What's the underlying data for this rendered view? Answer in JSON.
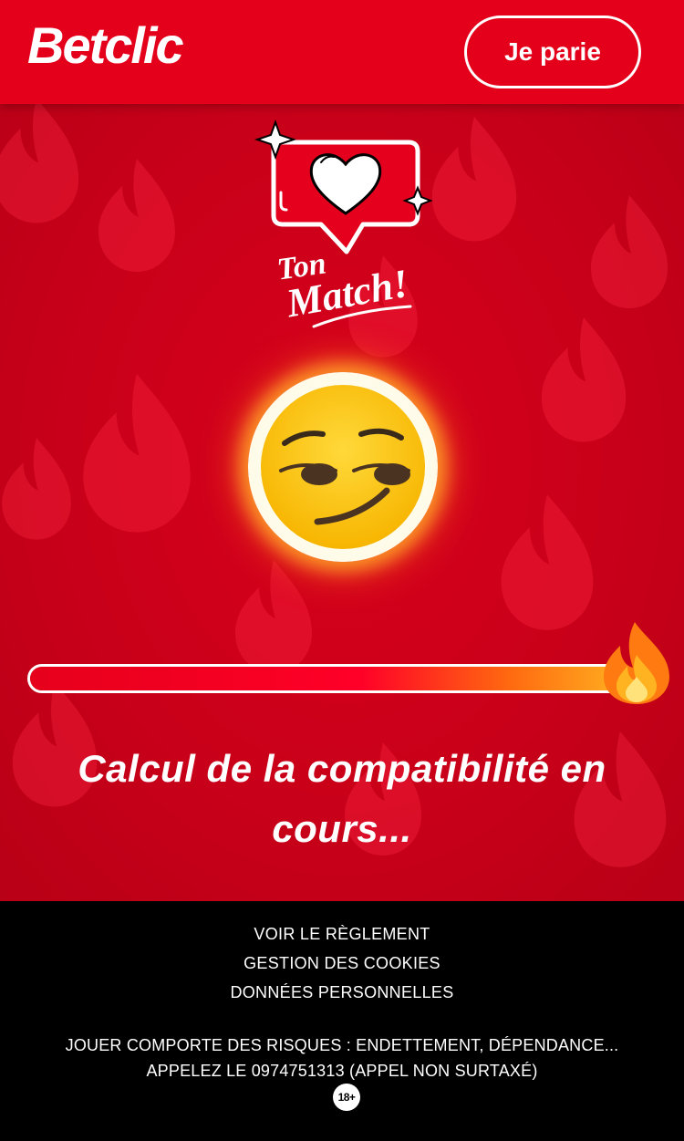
{
  "header": {
    "logo_text": "Betclic",
    "cta_label": "Je parie"
  },
  "hero": {
    "badge_line1": "Ton",
    "badge_line2": "Match!",
    "emoji": "smirking-face"
  },
  "progress": {
    "value_percent": 100
  },
  "status": {
    "text": "Calcul de la compatibilité en cours..."
  },
  "footer": {
    "links": [
      "VOIR LE RÈGLEMENT",
      "GESTION DES COOKIES",
      "DONNÉES PERSONNELLES"
    ],
    "warning_line1": "JOUER COMPORTE DES RISQUES : ENDETTEMENT, DÉPENDANCE...",
    "warning_line2": "APPELEZ LE 0974751313 (APPEL NON SURTAXÉ)",
    "age_badge": "18+"
  },
  "colors": {
    "brand_red": "#e4001b",
    "footer_bg": "#000000",
    "text_white": "#ffffff",
    "emoji_yellow": "#ffc928"
  }
}
